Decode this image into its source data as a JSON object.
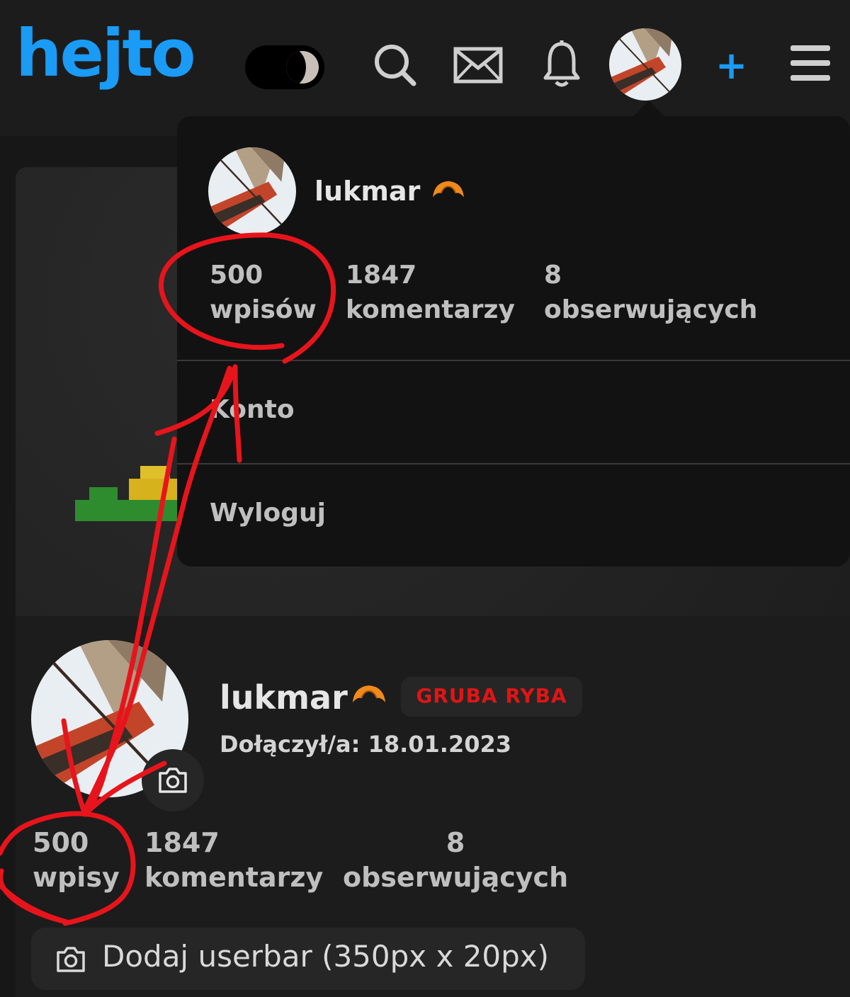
{
  "header": {
    "logo": "hejto",
    "theme_toggle": "dark",
    "icons": [
      "search-icon",
      "mail-icon",
      "bell-icon",
      "plus-icon",
      "menu-icon"
    ],
    "plus_label": "+",
    "accent": "#1a9bf5"
  },
  "dropdown": {
    "username": "lukmar",
    "stats": [
      {
        "value": "500",
        "label": "wpisów"
      },
      {
        "value": "1847",
        "label": "komentarzy"
      },
      {
        "value": "8",
        "label": "obserwujących"
      }
    ],
    "items": [
      "Konto",
      "Wyloguj"
    ]
  },
  "profile": {
    "username": "lukmar",
    "badge": "GRUBA RYBA",
    "badge_color": "#e01515",
    "joined": "Dołączył/a: 18.01.2023",
    "stats": [
      {
        "value": "500",
        "label": "wpisy"
      },
      {
        "value": "1847",
        "label": "komentarzy"
      },
      {
        "value": "8",
        "label": "obserwujących"
      }
    ],
    "userbar_button": "Dodaj userbar (350px x 20px)"
  }
}
